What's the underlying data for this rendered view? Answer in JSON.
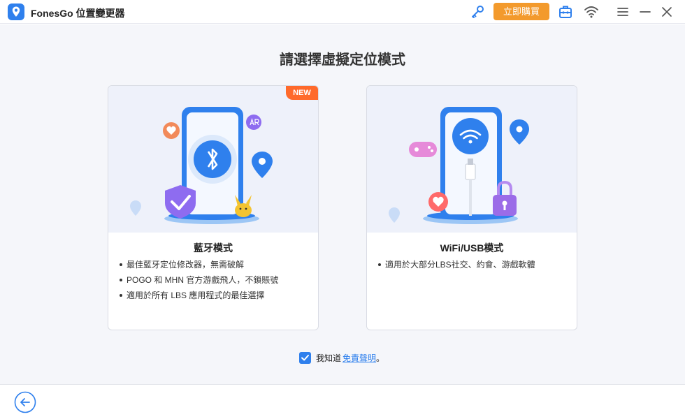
{
  "app": {
    "title": "FonesGo 位置變更器",
    "buy_label": "立即購買",
    "colors": {
      "accent": "#2f80ed",
      "buy": "#f39a2c",
      "badge": "#ff6a2b"
    }
  },
  "main": {
    "title": "請選擇虛擬定位模式",
    "cards": [
      {
        "badge": "NEW",
        "title": "藍牙模式",
        "icon": "bluetooth-icon",
        "features": [
          "最佳藍牙定位修改器，無需破解",
          "POGO 和 MHN 官方游戲飛人，不鎖賬號",
          "適用於所有 LBS 應用程式的最佳選擇"
        ]
      },
      {
        "title": "WiFi/USB模式",
        "icon": "wifi-icon",
        "features": [
          "適用於大部分LBS社交、約會、游戲軟體"
        ]
      }
    ],
    "agreement": {
      "checked": true,
      "text": "我知道",
      "link": "免責聲明",
      "suffix": "。"
    }
  },
  "footer": {
    "back_icon": "arrow-left-icon"
  }
}
